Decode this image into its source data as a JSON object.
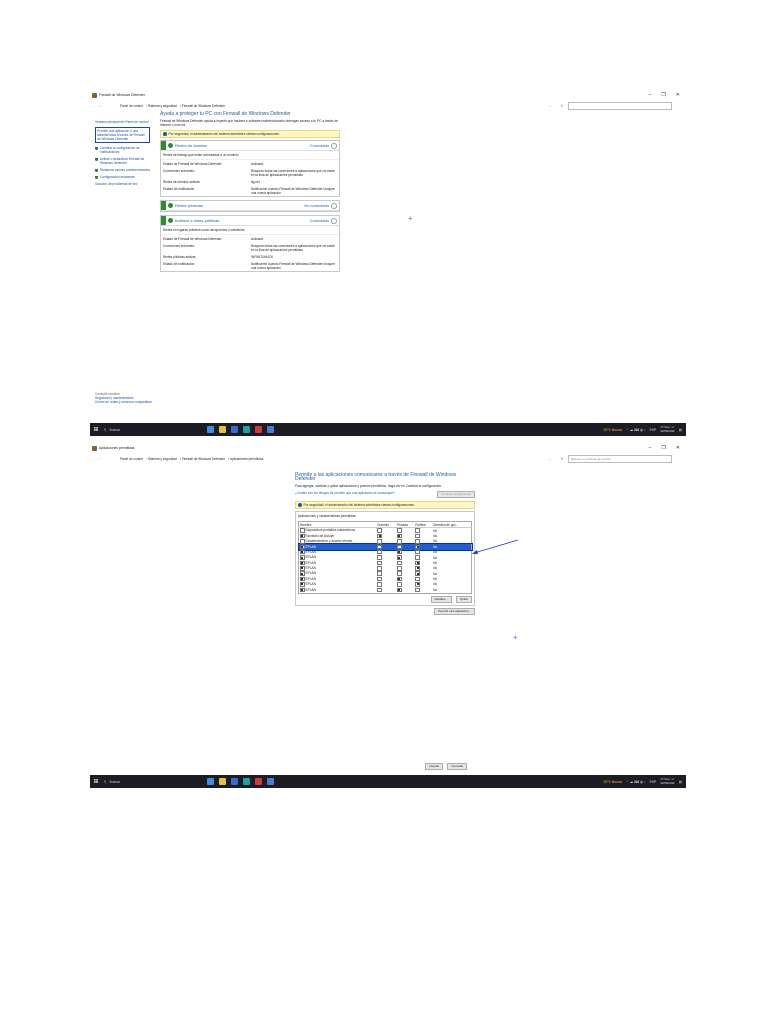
{
  "shot1": {
    "window_title": "Firewall de Windows Defender",
    "window_buttons": [
      "–",
      "❐",
      "✕"
    ],
    "breadcrumbs": [
      "Panel de control",
      "Sistema y seguridad",
      "Firewall de Windows Defender"
    ],
    "sidebar": {
      "items": [
        {
          "label": "Ventana principal del Panel de control",
          "shield": false,
          "highlight": false
        },
        {
          "label": "Permitir una aplicación o una característica a través de Firewall de Windows Defender",
          "shield": false,
          "highlight": true
        },
        {
          "label": "Cambiar la configuración de notificaciones",
          "shield": true,
          "highlight": false
        },
        {
          "label": "Activar o desactivar Firewall de Windows Defender",
          "shield": true,
          "highlight": false
        },
        {
          "label": "Restaurar valores predeterminados",
          "shield": true,
          "highlight": false
        },
        {
          "label": "Configuración avanzada",
          "shield": true,
          "highlight": false
        },
        {
          "label": "Solución de problemas de red",
          "shield": false,
          "highlight": false
        }
      ],
      "see_also_caption": "Consulte también",
      "see_also": [
        "Seguridad y mantenimiento",
        "Centro de redes y recursos compartidos"
      ]
    },
    "heading": "Ayuda a proteger tu PC con Firewall de Windows Defender",
    "description": "Firewall de Windows Defender ayuda a impedir que hackers o software malintencionado obtengan acceso a tu PC a través de Internet o una red.",
    "warning": "Por seguridad, el administrador del sistema administra ciertas configuraciones.",
    "networks": [
      {
        "name": "Redes de dominio",
        "status": "Conectado",
        "subtitle": "Redes de trabajo que están conectadas a un dominio",
        "rows": [
          {
            "k": "Estado de Firewall de Windows Defender:",
            "v": "Activado"
          },
          {
            "k": "Conexiones entrantes:",
            "v": "Bloquear todas las conexiones a aplicaciones que no están en la lista de aplicaciones permitidas"
          },
          {
            "k": "Redes de dominio activas:",
            "v": "itg.net"
          },
          {
            "k": "Estado de notificación:",
            "v": "Notificarme cuando Firewall de Windows Defender bloquee una nueva aplicación"
          }
        ]
      },
      {
        "name": "Redes privadas",
        "status": "No conectado",
        "subtitle": "",
        "rows": []
      },
      {
        "name": "Invitado o redes públicas",
        "status": "Conectado",
        "subtitle": "Redes en lugares públicos como aeropuertos o cafeterías",
        "rows": [
          {
            "k": "Estado de Firewall de Windows Defender:",
            "v": "Activado"
          },
          {
            "k": "Conexiones entrantes:",
            "v": "Bloquear todas las conexiones a aplicaciones que no están en la lista de aplicaciones permitidas"
          },
          {
            "k": "Redes públicas activas:",
            "v": "INFINITUM4C6"
          },
          {
            "k": "Estado de notificación:",
            "v": "Notificarme cuando Firewall de Windows Defender bloquee una nueva aplicación"
          }
        ]
      }
    ]
  },
  "shot2": {
    "window_title": "Aplicaciones permitidas",
    "window_buttons": [
      "–",
      "❐",
      "✕"
    ],
    "breadcrumbs": [
      "Panel de control",
      "Sistema y seguridad",
      "Firewall de Windows Defender",
      "Aplicaciones permitidas"
    ],
    "search_placeholder": "Buscar en el Panel de control",
    "heading": "Permitir a las aplicaciones comunicarse a través de Firewall de Windows Defender",
    "description": "Para agregar, cambiar o quitar aplicaciones y puertos permitidos, haga clic en Cambiar la configuración.",
    "risk_link": "¿Cuáles son los riesgos de permitir que una aplicación se comunique?",
    "change_settings": "Cambiar configuración",
    "warning": "Por seguridad, el administrador del sistema administra ciertas configuraciones.",
    "apps_caption": "Aplicaciones y características permitidas:",
    "columns": [
      "Nombre",
      "Dominio",
      "Privada",
      "Pública",
      "Directiva de gru..."
    ],
    "rows": [
      {
        "name": "Dispositivos portátiles inalámbricos",
        "checked": false,
        "d": false,
        "p": false,
        "u": false,
        "g": "No",
        "sel": false
      },
      {
        "name": "Escritorio de AllJoyn",
        "checked": true,
        "d": true,
        "p": true,
        "u": false,
        "g": "No",
        "sel": false
      },
      {
        "name": "Establecimiento y acceso remoto",
        "checked": false,
        "d": false,
        "p": false,
        "u": false,
        "g": "No",
        "sel": false
      },
      {
        "name": "EPLAN",
        "checked": true,
        "d": false,
        "p": false,
        "u": true,
        "g": "No",
        "sel": true
      },
      {
        "name": "EPLAN",
        "checked": true,
        "d": false,
        "p": true,
        "u": false,
        "g": "No",
        "sel": false
      },
      {
        "name": "EPLAN",
        "checked": true,
        "d": false,
        "p": true,
        "u": false,
        "g": "No",
        "sel": false
      },
      {
        "name": "EPLAN",
        "checked": true,
        "d": false,
        "p": false,
        "u": true,
        "g": "No",
        "sel": false
      },
      {
        "name": "EPLAN",
        "checked": true,
        "d": false,
        "p": false,
        "u": true,
        "g": "No",
        "sel": false
      },
      {
        "name": "EPLAN",
        "checked": true,
        "d": false,
        "p": false,
        "u": true,
        "g": "No",
        "sel": false
      },
      {
        "name": "EPLAN",
        "checked": true,
        "d": false,
        "p": true,
        "u": false,
        "g": "No",
        "sel": false
      },
      {
        "name": "EPLAN",
        "checked": true,
        "d": false,
        "p": false,
        "u": true,
        "g": "No",
        "sel": false
      },
      {
        "name": "EPLAN",
        "checked": true,
        "d": false,
        "p": true,
        "u": false,
        "g": "No",
        "sel": false
      }
    ],
    "details_button": "Detalles...",
    "remove_button": "Quitar",
    "allow_other_button": "Permitir otra aplicación...",
    "ok_button": "Aceptar",
    "cancel_button": "Cancelar"
  },
  "taskbar": {
    "search_placeholder": "Buscar",
    "weather": "29°C Bruma",
    "lang": "ESP",
    "time": "17:50 p. m.",
    "date": "22/08/2022",
    "app_colors": [
      "#3a8ee6",
      "#e6c03a",
      "#2f6fd1",
      "#1aa3a3",
      "#d13a3a",
      "#4a7ad6"
    ]
  }
}
